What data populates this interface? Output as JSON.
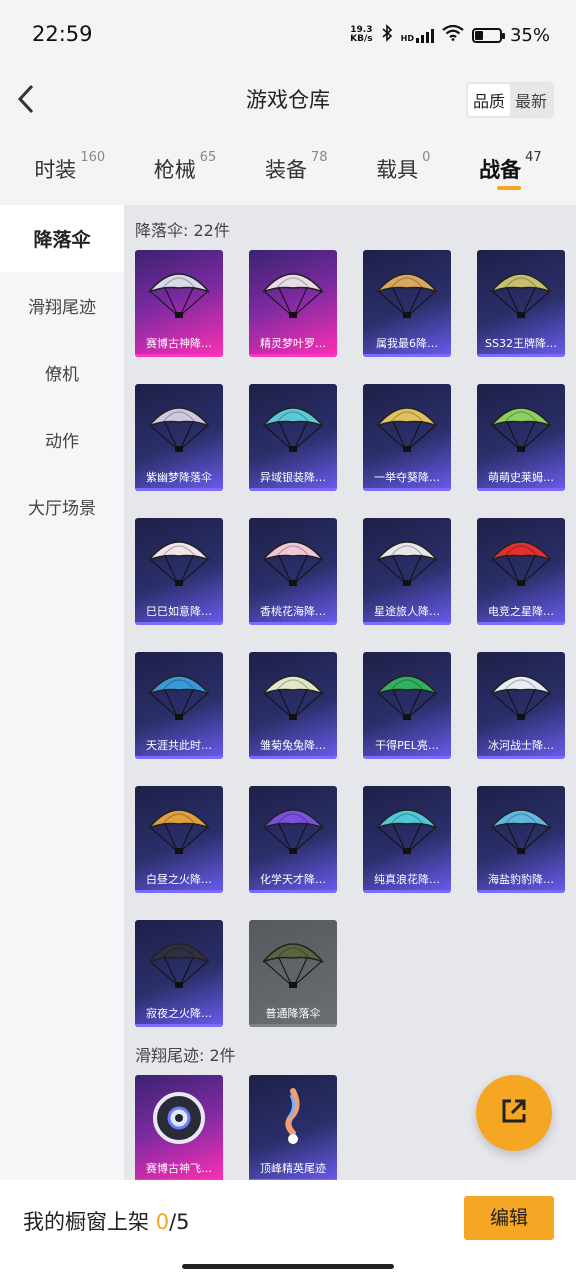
{
  "status_bar": {
    "time": "22:59",
    "net_speed_value": "19.3",
    "net_speed_unit": "KB/s",
    "hd_label": "HD",
    "battery": "35%",
    "battery_level": 0.35,
    "icons": [
      "bluetooth-icon",
      "signal-icon",
      "wifi-icon",
      "battery-icon"
    ]
  },
  "header": {
    "title": "游戏仓库",
    "back_icon": "back-arrow-icon",
    "sort_options": [
      "品质",
      "最新"
    ],
    "sort_selected": "品质"
  },
  "tabs": [
    {
      "label": "时装",
      "count": "160"
    },
    {
      "label": "枪械",
      "count": "65"
    },
    {
      "label": "装备",
      "count": "78"
    },
    {
      "label": "载具",
      "count": "0"
    },
    {
      "label": "战备",
      "count": "47",
      "active": true
    }
  ],
  "sidebar": {
    "items": [
      "降落伞",
      "滑翔尾迹",
      "僚机",
      "动作",
      "大厅场景"
    ],
    "active": "降落伞"
  },
  "sections": [
    {
      "title": "降落伞: 22件",
      "items": [
        {
          "name": "赛博古神降…",
          "rarity": "pink",
          "color": "#d9d9e8"
        },
        {
          "name": "精灵梦叶罗…",
          "rarity": "pink",
          "color": "#e8dde6"
        },
        {
          "name": "属我最6降…",
          "rarity": "blue",
          "color": "#d8a860"
        },
        {
          "name": "SS32王牌降…",
          "rarity": "blue",
          "color": "#c8c070"
        },
        {
          "name": "紫幽梦降落伞",
          "rarity": "blue",
          "color": "#cfc8e0"
        },
        {
          "name": "异域银装降…",
          "rarity": "blue",
          "color": "#5cc8d8"
        },
        {
          "name": "一举夺葵降…",
          "rarity": "blue",
          "color": "#e0c060"
        },
        {
          "name": "萌萌史莱姆…",
          "rarity": "blue",
          "color": "#8ed060"
        },
        {
          "name": "巳巳如意降…",
          "rarity": "blue",
          "color": "#f0e6ea"
        },
        {
          "name": "香桃花海降…",
          "rarity": "blue",
          "color": "#f2c8d8"
        },
        {
          "name": "星途旅人降…",
          "rarity": "blue",
          "color": "#e8e8ec"
        },
        {
          "name": "电竞之星降…",
          "rarity": "blue",
          "color": "#e03030"
        },
        {
          "name": "天涯共此时…",
          "rarity": "blue",
          "color": "#3a9ad8"
        },
        {
          "name": "雏菊兔兔降…",
          "rarity": "blue",
          "color": "#e0e8c8"
        },
        {
          "name": "干得PEL亮…",
          "rarity": "blue",
          "color": "#30b060"
        },
        {
          "name": "冰河战士降…",
          "rarity": "blue",
          "color": "#e8ecf4"
        },
        {
          "name": "白昼之火降…",
          "rarity": "blue",
          "color": "#e0a040"
        },
        {
          "name": "化学天才降…",
          "rarity": "blue",
          "color": "#7a50e0"
        },
        {
          "name": "纯真浪花降…",
          "rarity": "blue",
          "color": "#50c8d8"
        },
        {
          "name": "海盐豹豹降…",
          "rarity": "blue",
          "color": "#60b8e0"
        },
        {
          "name": "寂夜之火降…",
          "rarity": "blue",
          "color": "#303040"
        },
        {
          "name": "普通降落伞",
          "rarity": "gray",
          "color": "#5a6440"
        }
      ]
    },
    {
      "title": "滑翔尾迹: 2件",
      "items": [
        {
          "name": "赛博古神飞…",
          "rarity": "pink",
          "color": "#e8e8f0"
        },
        {
          "name": "顶峰精英尾迹",
          "rarity": "blue",
          "color": "#f0a070"
        }
      ]
    }
  ],
  "fab": {
    "icon": "share-external-icon"
  },
  "bottom_bar": {
    "showcase_label": "我的橱窗上架",
    "showcase_count": "0",
    "showcase_total": "/5",
    "edit_label": "编辑"
  }
}
